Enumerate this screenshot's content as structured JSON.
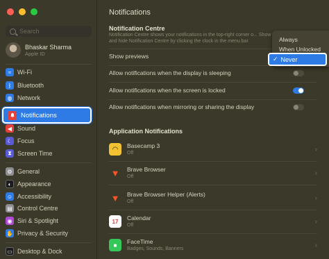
{
  "sidebar": {
    "search_placeholder": "Search",
    "account": {
      "name": "Bhaskar Sharma",
      "sub": "Apple ID"
    },
    "items_top": [
      {
        "label": "Wi-Fi",
        "icon": "wifi-icon",
        "color": "#2f7be5",
        "glyph": "≈"
      },
      {
        "label": "Bluetooth",
        "icon": "bluetooth-icon",
        "color": "#2f7be5",
        "glyph": "ᛒ"
      },
      {
        "label": "Network",
        "icon": "globe-icon",
        "color": "#2f7be5",
        "glyph": "◍"
      }
    ],
    "selected": {
      "label": "Notifications",
      "icon": "bell-icon",
      "color": "#e6403a"
    },
    "items_mid": [
      {
        "label": "Sound",
        "icon": "speaker-icon",
        "color": "#e6403a",
        "glyph": "◀"
      },
      {
        "label": "Focus",
        "icon": "moon-icon",
        "color": "#5b5ad6",
        "glyph": "☾"
      },
      {
        "label": "Screen Time",
        "icon": "hourglass-icon",
        "color": "#5b5ad6",
        "glyph": "⧗"
      }
    ],
    "items_bottom": [
      {
        "label": "General",
        "icon": "gear-icon",
        "color": "#8e8e93",
        "glyph": "⚙"
      },
      {
        "label": "Appearance",
        "icon": "appearance-icon",
        "color": "#1c1c1e",
        "glyph": "◐"
      },
      {
        "label": "Accessibility",
        "icon": "accessibility-icon",
        "color": "#2f7be5",
        "glyph": "☺"
      },
      {
        "label": "Control Centre",
        "icon": "control-centre-icon",
        "color": "#8e8e93",
        "glyph": "▤"
      },
      {
        "label": "Siri & Spotlight",
        "icon": "siri-icon",
        "color": "#b04bd8",
        "glyph": "◉"
      },
      {
        "label": "Privacy & Security",
        "icon": "hand-icon",
        "color": "#2f7be5",
        "glyph": "✋"
      }
    ],
    "items_last": [
      {
        "label": "Desktop & Dock",
        "icon": "dock-icon",
        "color": "#1c1c1e",
        "glyph": "▭"
      }
    ]
  },
  "main": {
    "title": "Notifications",
    "section_title": "Notification Centre",
    "description": "Notification Centre shows your notifications in the top-right corner o... Show and hide Notification Centre by clicking the clock in the menu bar",
    "settings": [
      {
        "label": "Show previews"
      },
      {
        "label": "Allow notifications when the display is sleeping",
        "on": false
      },
      {
        "label": "Allow notifications when the screen is locked",
        "on": true
      },
      {
        "label": "Allow notifications when mirroring or sharing the display",
        "on": false
      }
    ],
    "app_section_title": "Application Notifications",
    "apps": [
      {
        "name": "Basecamp 3",
        "sub": "Off",
        "icon": "basecamp-icon",
        "color": "#f2c230",
        "glyph": "◠"
      },
      {
        "name": "Brave Browser",
        "sub": "Off",
        "icon": "brave-icon",
        "color": "#fb542b",
        "glyph": "▼"
      },
      {
        "name": "Brave Browser Helper (Alerts)",
        "sub": "Off",
        "icon": "brave-helper-icon",
        "color": "#fb542b",
        "glyph": "▼"
      },
      {
        "name": "Calendar",
        "sub": "Off",
        "icon": "calendar-icon",
        "color": "#ffffff",
        "glyph": "17"
      },
      {
        "name": "FaceTime",
        "sub": "Badges, Sounds, Banners",
        "icon": "facetime-icon",
        "color": "#34c759",
        "glyph": "■"
      }
    ]
  },
  "dropdown": {
    "options": [
      "Always",
      "When Unlocked",
      "Never"
    ],
    "selected": "Never",
    "check": "✓"
  },
  "colors": {
    "accent": "#2f7be5",
    "traffic_red": "#ff5f57",
    "traffic_yellow": "#febc2e",
    "traffic_green": "#28c840"
  }
}
